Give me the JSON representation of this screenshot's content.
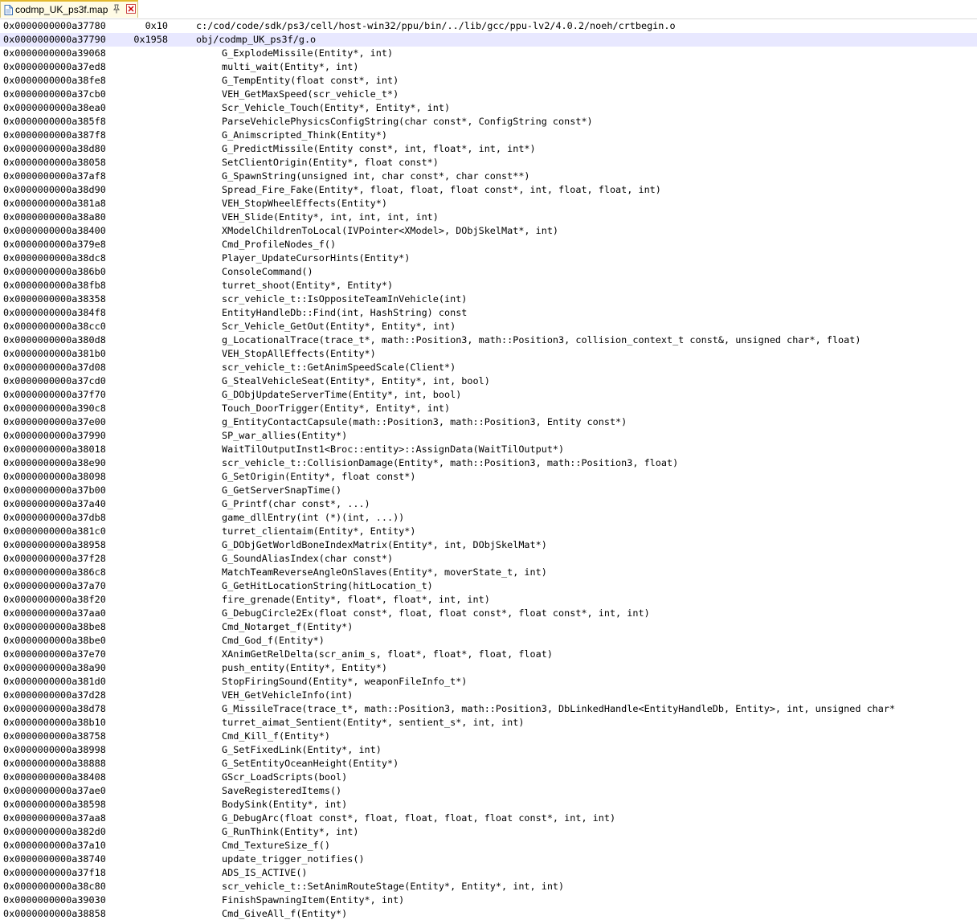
{
  "tab": {
    "title": "codmp_UK_ps3f.map",
    "icons": [
      "file-icon",
      "pin-icon",
      "close-icon"
    ]
  },
  "editor": {
    "current_line_index": 1,
    "current_line_color": "#e8e8ff",
    "lines": [
      {
        "addr": "0x0000000000a37780",
        "size": "0x10",
        "obj": "c:/cod/code/sdk/ps3/cell/host-win32/ppu/bin/../lib/gcc/ppu-lv2/4.0.2/noeh/crtbegin.o"
      },
      {
        "addr": "0x0000000000a37790",
        "size": "0x1958",
        "obj": "obj/codmp_UK_ps3f/g.o"
      },
      {
        "addr": "0x0000000000a39068",
        "sym": "G_ExplodeMissile(Entity*, int)"
      },
      {
        "addr": "0x0000000000a37ed8",
        "sym": "multi_wait(Entity*, int)"
      },
      {
        "addr": "0x0000000000a38fe8",
        "sym": "G_TempEntity(float const*, int)"
      },
      {
        "addr": "0x0000000000a37cb0",
        "sym": "VEH_GetMaxSpeed(scr_vehicle_t*)"
      },
      {
        "addr": "0x0000000000a38ea0",
        "sym": "Scr_Vehicle_Touch(Entity*, Entity*, int)"
      },
      {
        "addr": "0x0000000000a385f8",
        "sym": "ParseVehiclePhysicsConfigString(char const*, ConfigString const*)"
      },
      {
        "addr": "0x0000000000a387f8",
        "sym": "G_Animscripted_Think(Entity*)"
      },
      {
        "addr": "0x0000000000a38d80",
        "sym": "G_PredictMissile(Entity const*, int, float*, int, int*)"
      },
      {
        "addr": "0x0000000000a38058",
        "sym": "SetClientOrigin(Entity*, float const*)"
      },
      {
        "addr": "0x0000000000a37af8",
        "sym": "G_SpawnString(unsigned int, char const*, char const**)"
      },
      {
        "addr": "0x0000000000a38d90",
        "sym": "Spread_Fire_Fake(Entity*, float, float, float const*, int, float, float, int)"
      },
      {
        "addr": "0x0000000000a381a8",
        "sym": "VEH_StopWheelEffects(Entity*)"
      },
      {
        "addr": "0x0000000000a38a80",
        "sym": "VEH_Slide(Entity*, int, int, int, int)"
      },
      {
        "addr": "0x0000000000a38400",
        "sym": "XModelChildrenToLocal(IVPointer<XModel>, DObjSkelMat*, int)"
      },
      {
        "addr": "0x0000000000a379e8",
        "sym": "Cmd_ProfileNodes_f()"
      },
      {
        "addr": "0x0000000000a38dc8",
        "sym": "Player_UpdateCursorHints(Entity*)"
      },
      {
        "addr": "0x0000000000a386b0",
        "sym": "ConsoleCommand()"
      },
      {
        "addr": "0x0000000000a38fb8",
        "sym": "turret_shoot(Entity*, Entity*)"
      },
      {
        "addr": "0x0000000000a38358",
        "sym": "scr_vehicle_t::IsOppositeTeamInVehicle(int)"
      },
      {
        "addr": "0x0000000000a384f8",
        "sym": "EntityHandleDb::Find(int, HashString) const"
      },
      {
        "addr": "0x0000000000a38cc0",
        "sym": "Scr_Vehicle_GetOut(Entity*, Entity*, int)"
      },
      {
        "addr": "0x0000000000a380d8",
        "sym": "g_LocationalTrace(trace_t*, math::Position3, math::Position3, collision_context_t const&, unsigned char*, float)"
      },
      {
        "addr": "0x0000000000a381b0",
        "sym": "VEH_StopAllEffects(Entity*)"
      },
      {
        "addr": "0x0000000000a37d08",
        "sym": "scr_vehicle_t::GetAnimSpeedScale(Client*)"
      },
      {
        "addr": "0x0000000000a37cd0",
        "sym": "G_StealVehicleSeat(Entity*, Entity*, int, bool)"
      },
      {
        "addr": "0x0000000000a37f70",
        "sym": "G_DObjUpdateServerTime(Entity*, int, bool)"
      },
      {
        "addr": "0x0000000000a390c8",
        "sym": "Touch_DoorTrigger(Entity*, Entity*, int)"
      },
      {
        "addr": "0x0000000000a37e00",
        "sym": "g_EntityContactCapsule(math::Position3, math::Position3, Entity const*)"
      },
      {
        "addr": "0x0000000000a37990",
        "sym": "SP_war_allies(Entity*)"
      },
      {
        "addr": "0x0000000000a38018",
        "sym": "WaitTilOutputInst1<Broc::entity>::AssignData(WaitTilOutput*)"
      },
      {
        "addr": "0x0000000000a38e90",
        "sym": "scr_vehicle_t::CollisionDamage(Entity*, math::Position3, math::Position3, float)"
      },
      {
        "addr": "0x0000000000a38098",
        "sym": "G_SetOrigin(Entity*, float const*)"
      },
      {
        "addr": "0x0000000000a37b00",
        "sym": "G_GetServerSnapTime()"
      },
      {
        "addr": "0x0000000000a37a40",
        "sym": "G_Printf(char const*, ...)"
      },
      {
        "addr": "0x0000000000a37db8",
        "sym": "game_dllEntry(int (*)(int, ...))"
      },
      {
        "addr": "0x0000000000a381c0",
        "sym": "turret_clientaim(Entity*, Entity*)"
      },
      {
        "addr": "0x0000000000a38958",
        "sym": "G_DObjGetWorldBoneIndexMatrix(Entity*, int, DObjSkelMat*)"
      },
      {
        "addr": "0x0000000000a37f28",
        "sym": "G_SoundAliasIndex(char const*)"
      },
      {
        "addr": "0x0000000000a386c8",
        "sym": "MatchTeamReverseAngleOnSlaves(Entity*, moverState_t, int)"
      },
      {
        "addr": "0x0000000000a37a70",
        "sym": "G_GetHitLocationString(hitLocation_t)"
      },
      {
        "addr": "0x0000000000a38f20",
        "sym": "fire_grenade(Entity*, float*, float*, int, int)"
      },
      {
        "addr": "0x0000000000a37aa0",
        "sym": "G_DebugCircle2Ex(float const*, float, float const*, float const*, int, int)"
      },
      {
        "addr": "0x0000000000a38be8",
        "sym": "Cmd_Notarget_f(Entity*)"
      },
      {
        "addr": "0x0000000000a38be0",
        "sym": "Cmd_God_f(Entity*)"
      },
      {
        "addr": "0x0000000000a37e70",
        "sym": "XAnimGetRelDelta(scr_anim_s, float*, float*, float, float)"
      },
      {
        "addr": "0x0000000000a38a90",
        "sym": "push_entity(Entity*, Entity*)"
      },
      {
        "addr": "0x0000000000a381d0",
        "sym": "StopFiringSound(Entity*, weaponFileInfo_t*)"
      },
      {
        "addr": "0x0000000000a37d28",
        "sym": "VEH_GetVehicleInfo(int)"
      },
      {
        "addr": "0x0000000000a38d78",
        "sym": "G_MissileTrace(trace_t*, math::Position3, math::Position3, DbLinkedHandle<EntityHandleDb, Entity>, int, unsigned char*"
      },
      {
        "addr": "0x0000000000a38b10",
        "sym": "turret_aimat_Sentient(Entity*, sentient_s*, int, int)"
      },
      {
        "addr": "0x0000000000a38758",
        "sym": "Cmd_Kill_f(Entity*)"
      },
      {
        "addr": "0x0000000000a38998",
        "sym": "G_SetFixedLink(Entity*, int)"
      },
      {
        "addr": "0x0000000000a38888",
        "sym": "G_SetEntityOceanHeight(Entity*)"
      },
      {
        "addr": "0x0000000000a38408",
        "sym": "GScr_LoadScripts(bool)"
      },
      {
        "addr": "0x0000000000a37ae0",
        "sym": "SaveRegisteredItems()"
      },
      {
        "addr": "0x0000000000a38598",
        "sym": "BodySink(Entity*, int)"
      },
      {
        "addr": "0x0000000000a37aa8",
        "sym": "G_DebugArc(float const*, float, float, float, float const*, int, int)"
      },
      {
        "addr": "0x0000000000a382d0",
        "sym": "G_RunThink(Entity*, int)"
      },
      {
        "addr": "0x0000000000a37a10",
        "sym": "Cmd_TextureSize_f()"
      },
      {
        "addr": "0x0000000000a38740",
        "sym": "update_trigger_notifies()"
      },
      {
        "addr": "0x0000000000a37f18",
        "sym": "ADS_IS_ACTIVE()"
      },
      {
        "addr": "0x0000000000a38c80",
        "sym": "scr_vehicle_t::SetAnimRouteStage(Entity*, Entity*, int, int)"
      },
      {
        "addr": "0x0000000000a39030",
        "sym": "FinishSpawningItem(Entity*, int)"
      },
      {
        "addr": "0x0000000000a38858",
        "sym": "Cmd_GiveAll_f(Entity*)"
      }
    ]
  }
}
